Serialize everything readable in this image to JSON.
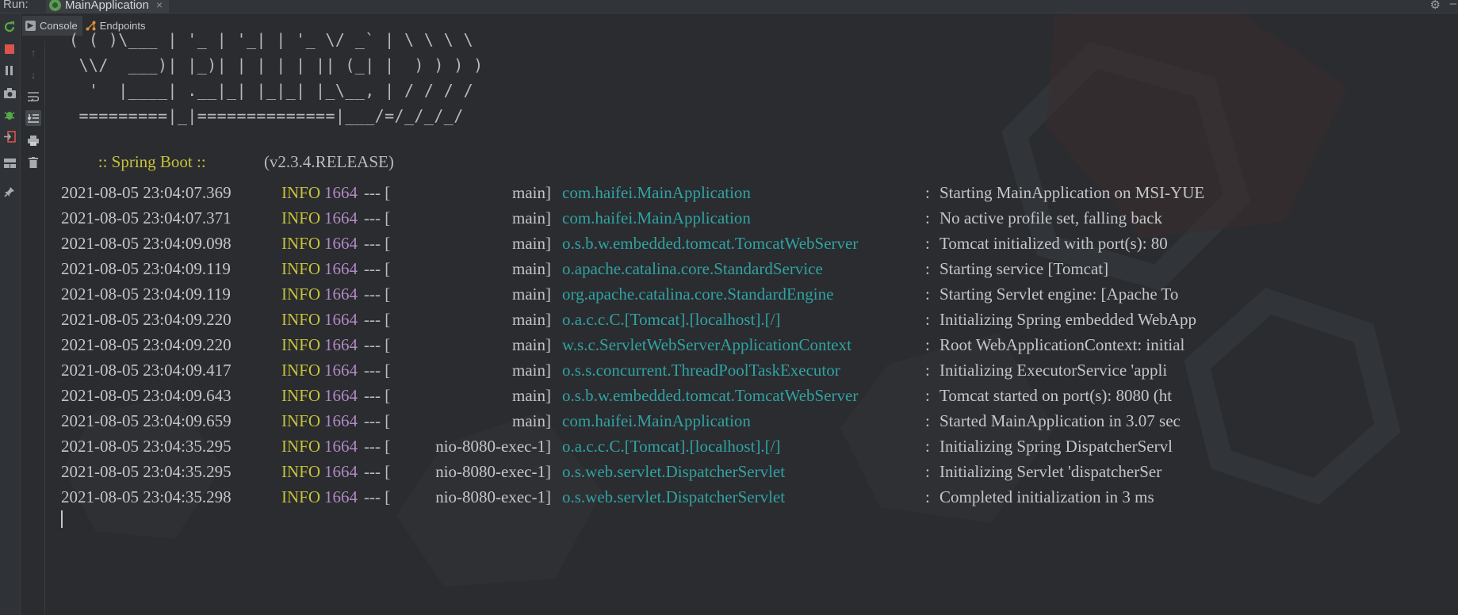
{
  "run_bar": {
    "label": "Run:",
    "tab_title": "MainApplication",
    "close_symbol": "×",
    "settings_icon": "gear-icon",
    "minimize_icon": "minimize-icon"
  },
  "tabs": [
    {
      "label": "Console",
      "icon": "console-icon",
      "selected": true
    },
    {
      "label": "Endpoints",
      "icon": "endpoints-icon",
      "selected": false
    }
  ],
  "left_toolbar": [
    "rerun-icon",
    "stop-icon",
    "pause-icon",
    "camera-icon",
    "debug-icon",
    "exit-icon",
    "layout-icon",
    "pin-icon"
  ],
  "console_toolbar": [
    "scroll-up-icon",
    "scroll-down-icon",
    "soft-wrap-icon",
    "scroll-to-end-icon",
    "print-icon",
    "clear-icon"
  ],
  "banner": {
    "lines": [
      "( ( )\\___ | '_ | '_| | '_ \\/ _` | \\ \\ \\ \\",
      " \\\\/  ___)| |_)| | | | | || (_| |  ) ) ) )",
      "  '  |____| .__|_| |_|_| |_\\__, | / / / /",
      " =========|_|==============|___/=/_/_/_/"
    ],
    "spring_label": " :: Spring Boot :: ",
    "spring_version": "(v2.3.4.RELEASE)"
  },
  "log_rows": [
    {
      "timestamp": "2021-08-05 23:04:07.369",
      "level": "INFO",
      "pid": "1664",
      "sep": "--- [",
      "thread": "main]",
      "logger": "com.haifei.MainApplication",
      "colon": ":",
      "message": "Starting MainApplication on MSI-YUE"
    },
    {
      "timestamp": "2021-08-05 23:04:07.371",
      "level": "INFO",
      "pid": "1664",
      "sep": "--- [",
      "thread": "main]",
      "logger": "com.haifei.MainApplication",
      "colon": ":",
      "message": "No active profile set, falling back"
    },
    {
      "timestamp": "2021-08-05 23:04:09.098",
      "level": "INFO",
      "pid": "1664",
      "sep": "--- [",
      "thread": "main]",
      "logger": "o.s.b.w.embedded.tomcat.TomcatWebServer",
      "colon": ":",
      "message": "Tomcat initialized with port(s): 80"
    },
    {
      "timestamp": "2021-08-05 23:04:09.119",
      "level": "INFO",
      "pid": "1664",
      "sep": "--- [",
      "thread": "main]",
      "logger": "o.apache.catalina.core.StandardService",
      "colon": ":",
      "message": "Starting service [Tomcat]"
    },
    {
      "timestamp": "2021-08-05 23:04:09.119",
      "level": "INFO",
      "pid": "1664",
      "sep": "--- [",
      "thread": "main]",
      "logger": "org.apache.catalina.core.StandardEngine",
      "colon": ":",
      "message": "Starting Servlet engine: [Apache To"
    },
    {
      "timestamp": "2021-08-05 23:04:09.220",
      "level": "INFO",
      "pid": "1664",
      "sep": "--- [",
      "thread": "main]",
      "logger": "o.a.c.c.C.[Tomcat].[localhost].[/]",
      "colon": ":",
      "message": "Initializing Spring embedded WebApp"
    },
    {
      "timestamp": "2021-08-05 23:04:09.220",
      "level": "INFO",
      "pid": "1664",
      "sep": "--- [",
      "thread": "main]",
      "logger": "w.s.c.ServletWebServerApplicationContext",
      "colon": ":",
      "message": "Root WebApplicationContext: initial"
    },
    {
      "timestamp": "2021-08-05 23:04:09.417",
      "level": "INFO",
      "pid": "1664",
      "sep": "--- [",
      "thread": "main]",
      "logger": "o.s.s.concurrent.ThreadPoolTaskExecutor",
      "colon": ":",
      "message": "Initializing ExecutorService 'appli"
    },
    {
      "timestamp": "2021-08-05 23:04:09.643",
      "level": "INFO",
      "pid": "1664",
      "sep": "--- [",
      "thread": "main]",
      "logger": "o.s.b.w.embedded.tomcat.TomcatWebServer",
      "colon": ":",
      "message": "Tomcat started on port(s): 8080 (ht"
    },
    {
      "timestamp": "2021-08-05 23:04:09.659",
      "level": "INFO",
      "pid": "1664",
      "sep": "--- [",
      "thread": "main]",
      "logger": "com.haifei.MainApplication",
      "colon": ":",
      "message": "Started MainApplication in 3.07 sec"
    },
    {
      "timestamp": "2021-08-05 23:04:35.295",
      "level": "INFO",
      "pid": "1664",
      "sep": "--- [",
      "thread": "nio-8080-exec-1]",
      "logger": "o.a.c.c.C.[Tomcat].[localhost].[/]",
      "colon": ":",
      "message": "Initializing Spring DispatcherServl"
    },
    {
      "timestamp": "2021-08-05 23:04:35.295",
      "level": "INFO",
      "pid": "1664",
      "sep": "--- [",
      "thread": "nio-8080-exec-1]",
      "logger": "o.s.web.servlet.DispatcherServlet",
      "colon": ":",
      "message": "Initializing Servlet 'dispatcherSer"
    },
    {
      "timestamp": "2021-08-05 23:04:35.298",
      "level": "INFO",
      "pid": "1664",
      "sep": "--- [",
      "thread": "nio-8080-exec-1]",
      "logger": "o.s.web.servlet.DispatcherServlet",
      "colon": ":",
      "message": "Completed initialization in 3 ms"
    }
  ],
  "colors": {
    "info": "#c7c23b",
    "pid": "#b289c7",
    "logger": "#31a2a3",
    "stop": "#d9534f",
    "rerun": "#57a64a"
  }
}
